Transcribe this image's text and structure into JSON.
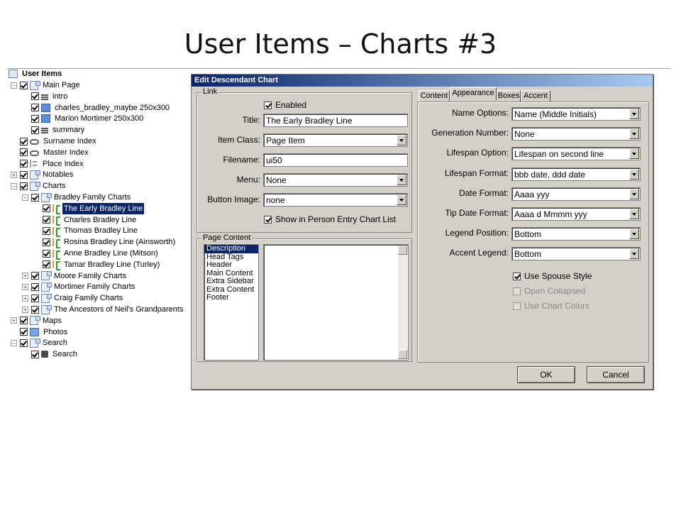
{
  "slide": {
    "title": "User Items – Charts #3"
  },
  "tree": {
    "root": "User Items",
    "rows": [
      {
        "label": "Main Page",
        "depth": 1,
        "exp": "−",
        "check": true,
        "icon": "page-icon"
      },
      {
        "label": "intro",
        "depth": 2,
        "exp": "",
        "check": true,
        "icon": "text-icon"
      },
      {
        "label": "charles_bradley_maybe 250x300",
        "depth": 2,
        "exp": "",
        "check": true,
        "icon": "image-icon"
      },
      {
        "label": "Marion Mortimer 250x300",
        "depth": 2,
        "exp": "",
        "check": true,
        "icon": "image-icon"
      },
      {
        "label": "summary",
        "depth": 2,
        "exp": "",
        "check": true,
        "icon": "text-icon"
      },
      {
        "label": "Surname Index",
        "depth": 1,
        "exp": "",
        "check": true,
        "icon": "link-icon"
      },
      {
        "label": "Master Index",
        "depth": 1,
        "exp": "",
        "check": true,
        "icon": "link-icon"
      },
      {
        "label": "Place Index",
        "depth": 1,
        "exp": "",
        "check": true,
        "icon": "tree-icon"
      },
      {
        "label": "Notables",
        "depth": 1,
        "exp": "+",
        "check": true,
        "icon": "page-icon"
      },
      {
        "label": "Charts",
        "depth": 1,
        "exp": "−",
        "check": true,
        "icon": "page-icon"
      },
      {
        "label": "Bradley Family Charts",
        "depth": 2,
        "exp": "−",
        "check": true,
        "icon": "page-icon"
      },
      {
        "label": "The Early Bradley Line",
        "depth": 3,
        "exp": "",
        "check": true,
        "icon": "chart-icon",
        "selected": true
      },
      {
        "label": "Charles Bradley Line",
        "depth": 3,
        "exp": "",
        "check": true,
        "icon": "chart-icon"
      },
      {
        "label": "Thomas Bradley Line",
        "depth": 3,
        "exp": "",
        "check": true,
        "icon": "chart-icon"
      },
      {
        "label": "Rosina Bradley Line (Ainsworth)",
        "depth": 3,
        "exp": "",
        "check": true,
        "icon": "chart-icon"
      },
      {
        "label": "Anne Bradley Line (Mitson)",
        "depth": 3,
        "exp": "",
        "check": true,
        "icon": "chart-icon"
      },
      {
        "label": "Tamar Bradley Line (Turley)",
        "depth": 3,
        "exp": "",
        "check": true,
        "icon": "chart-icon"
      },
      {
        "label": "Moore Family Charts",
        "depth": 2,
        "exp": "+",
        "check": true,
        "icon": "page-icon"
      },
      {
        "label": "Mortimer Family Charts",
        "depth": 2,
        "exp": "+",
        "check": true,
        "icon": "page-icon"
      },
      {
        "label": "Craig Family Charts",
        "depth": 2,
        "exp": "+",
        "check": true,
        "icon": "page-icon"
      },
      {
        "label": "The Ancestors of Neil's Grandparents",
        "depth": 2,
        "exp": "+",
        "check": true,
        "icon": "page-icon"
      },
      {
        "label": "Maps",
        "depth": 1,
        "exp": "+",
        "check": true,
        "icon": "page-icon"
      },
      {
        "label": "Photos",
        "depth": 1,
        "exp": "",
        "check": true,
        "icon": "photo-icon"
      },
      {
        "label": "Search",
        "depth": 1,
        "exp": "−",
        "check": true,
        "icon": "page-icon"
      },
      {
        "label": "Search",
        "depth": 2,
        "exp": "",
        "check": true,
        "icon": "search-icon"
      }
    ]
  },
  "dialog": {
    "title": "Edit Descendant Chart",
    "link": {
      "legend": "Link",
      "enabled_label": "Enabled",
      "title_label": "Title:",
      "title_value": "The Early Bradley Line",
      "item_class_label": "Item Class:",
      "item_class_value": "Page Item",
      "filename_label": "Filename:",
      "filename_value": "ui50",
      "menu_label": "Menu:",
      "menu_value": "None",
      "button_image_label": "Button Image:",
      "button_image_value": "none",
      "show_label": "Show in Person Entry Chart List"
    },
    "page_content": {
      "legend": "Page Content",
      "items": [
        "Description",
        "Head Tags",
        "Header",
        "Main Content",
        "Extra Sidebar",
        "Extra Content",
        "Footer"
      ],
      "selected_index": 0
    },
    "tabs": [
      "Content",
      "Appearance",
      "Boxes",
      "Accent"
    ],
    "active_tab": 1,
    "appearance": {
      "fields": [
        {
          "label": "Name Options:",
          "value": "Name (Middle Initials)"
        },
        {
          "label": "Generation Number:",
          "value": "None"
        },
        {
          "label": "Lifespan Option:",
          "value": "Lifespan on second line"
        },
        {
          "label": "Lifespan Format:",
          "value": "bbb date, ddd date"
        },
        {
          "label": "Date Format:",
          "value": "Aaaa yyy"
        },
        {
          "label": "Tip Date Format:",
          "value": "Aaaa d Mmmm yyy"
        },
        {
          "label": "Legend Position:",
          "value": "Bottom"
        },
        {
          "label": "Accent Legend:",
          "value": "Bottom"
        }
      ],
      "use_spouse_style": "Use Spouse Style",
      "open_collapsed": "Open Collapsed",
      "use_chart_colors": "Use Chart Colors"
    },
    "ok_label": "OK",
    "cancel_label": "Cancel"
  }
}
